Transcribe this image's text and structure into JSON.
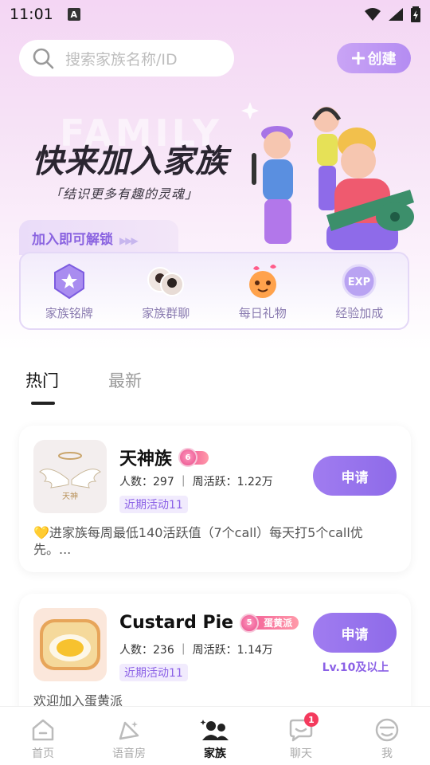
{
  "status_bar": {
    "time": "11:01",
    "a_icon": "A"
  },
  "search": {
    "placeholder": "搜索家族名称/ID"
  },
  "create_button": {
    "label": "创建"
  },
  "hero": {
    "watermark": "FAMILY",
    "title": "快来加入家族",
    "subtitle": "「结识更多有趣的灵魂」"
  },
  "unlock": {
    "title": "加入即可解锁",
    "arrows": "▶▶▶",
    "perks": [
      {
        "label": "家族铭牌",
        "icon": "badge-icon"
      },
      {
        "label": "家族群聊",
        "icon": "group-chat-icon"
      },
      {
        "label": "每日礼物",
        "icon": "gift-icon"
      },
      {
        "label": "经验加成",
        "icon": "exp-icon",
        "icon_text": "EXP"
      }
    ]
  },
  "tabs": [
    {
      "label": "热门",
      "active": true
    },
    {
      "label": "最新",
      "active": false
    }
  ],
  "families": [
    {
      "name": "天神族",
      "level": "6",
      "level_tag": "",
      "avatar_text": "天神",
      "stats": "人数：297 ｜ 周活跃：1.22万",
      "activity": "近期活动11",
      "apply_label": "申请",
      "requirement": "",
      "desc": "💛进家族每周最低140活跃值（7个call）每天打5个call优先。..."
    },
    {
      "name": "Custard Pie",
      "level": "5",
      "level_tag": "蛋黄派",
      "avatar_text": "",
      "stats": "人数：236 ｜ 周活跃：1.14万",
      "activity": "近期活动11",
      "apply_label": "申请",
      "requirement": "Lv.10及以上",
      "desc": "欢迎加入蛋黄派"
    }
  ],
  "tabbar": [
    {
      "label": "首页",
      "icon": "home-icon",
      "active": false
    },
    {
      "label": "语音房",
      "icon": "voice-room-icon",
      "active": false
    },
    {
      "label": "家族",
      "icon": "family-icon",
      "active": true
    },
    {
      "label": "聊天",
      "icon": "chat-icon",
      "active": false,
      "badge": "1"
    },
    {
      "label": "我",
      "icon": "profile-icon",
      "active": false
    }
  ],
  "colors": {
    "accent": "#8e6be9",
    "badge": "#f43a5d"
  }
}
